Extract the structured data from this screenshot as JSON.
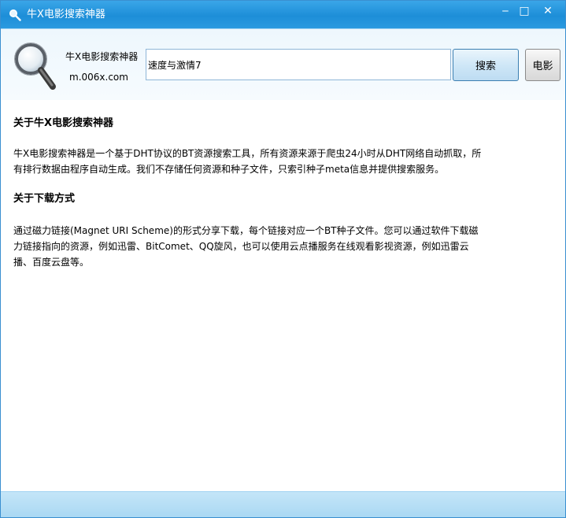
{
  "window": {
    "title": "牛X电影搜索神器",
    "minimize_glyph": "‒",
    "maximize_glyph": "□",
    "close_glyph": "✕"
  },
  "header": {
    "brand_name": "牛X电影搜索神器",
    "brand_url": "m.006x.com",
    "search_value": "速度与激情7",
    "search_button_label": "搜索",
    "movie_button_label": "电影"
  },
  "content": {
    "section1": {
      "title": "关于牛X电影搜索神器",
      "body": "牛X电影搜索神器是一个基于DHT协议的BT资源搜索工具，所有资源来源于爬虫24小时从DHT网络自动抓取，所有排行数据由程序自动生成。我们不存储任何资源和种子文件，只索引种子meta信息并提供搜索服务。"
    },
    "section2": {
      "title": "关于下载方式",
      "body": "通过磁力链接(Magnet URI Scheme)的形式分享下载，每个链接对应一个BT种子文件。您可以通过软件下载磁力链接指向的资源，例如迅雷、BitComet、QQ旋风，也可以使用云点播服务在线观看影视资源，例如迅雷云播、百度云盘等。"
    }
  },
  "icons": {
    "title": "magnifier-icon",
    "logo": "magnifier-icon"
  },
  "colors": {
    "titlebar": "#1d8ed8",
    "footer": "#a9d8f3",
    "header_bg": "#eef7fd"
  }
}
